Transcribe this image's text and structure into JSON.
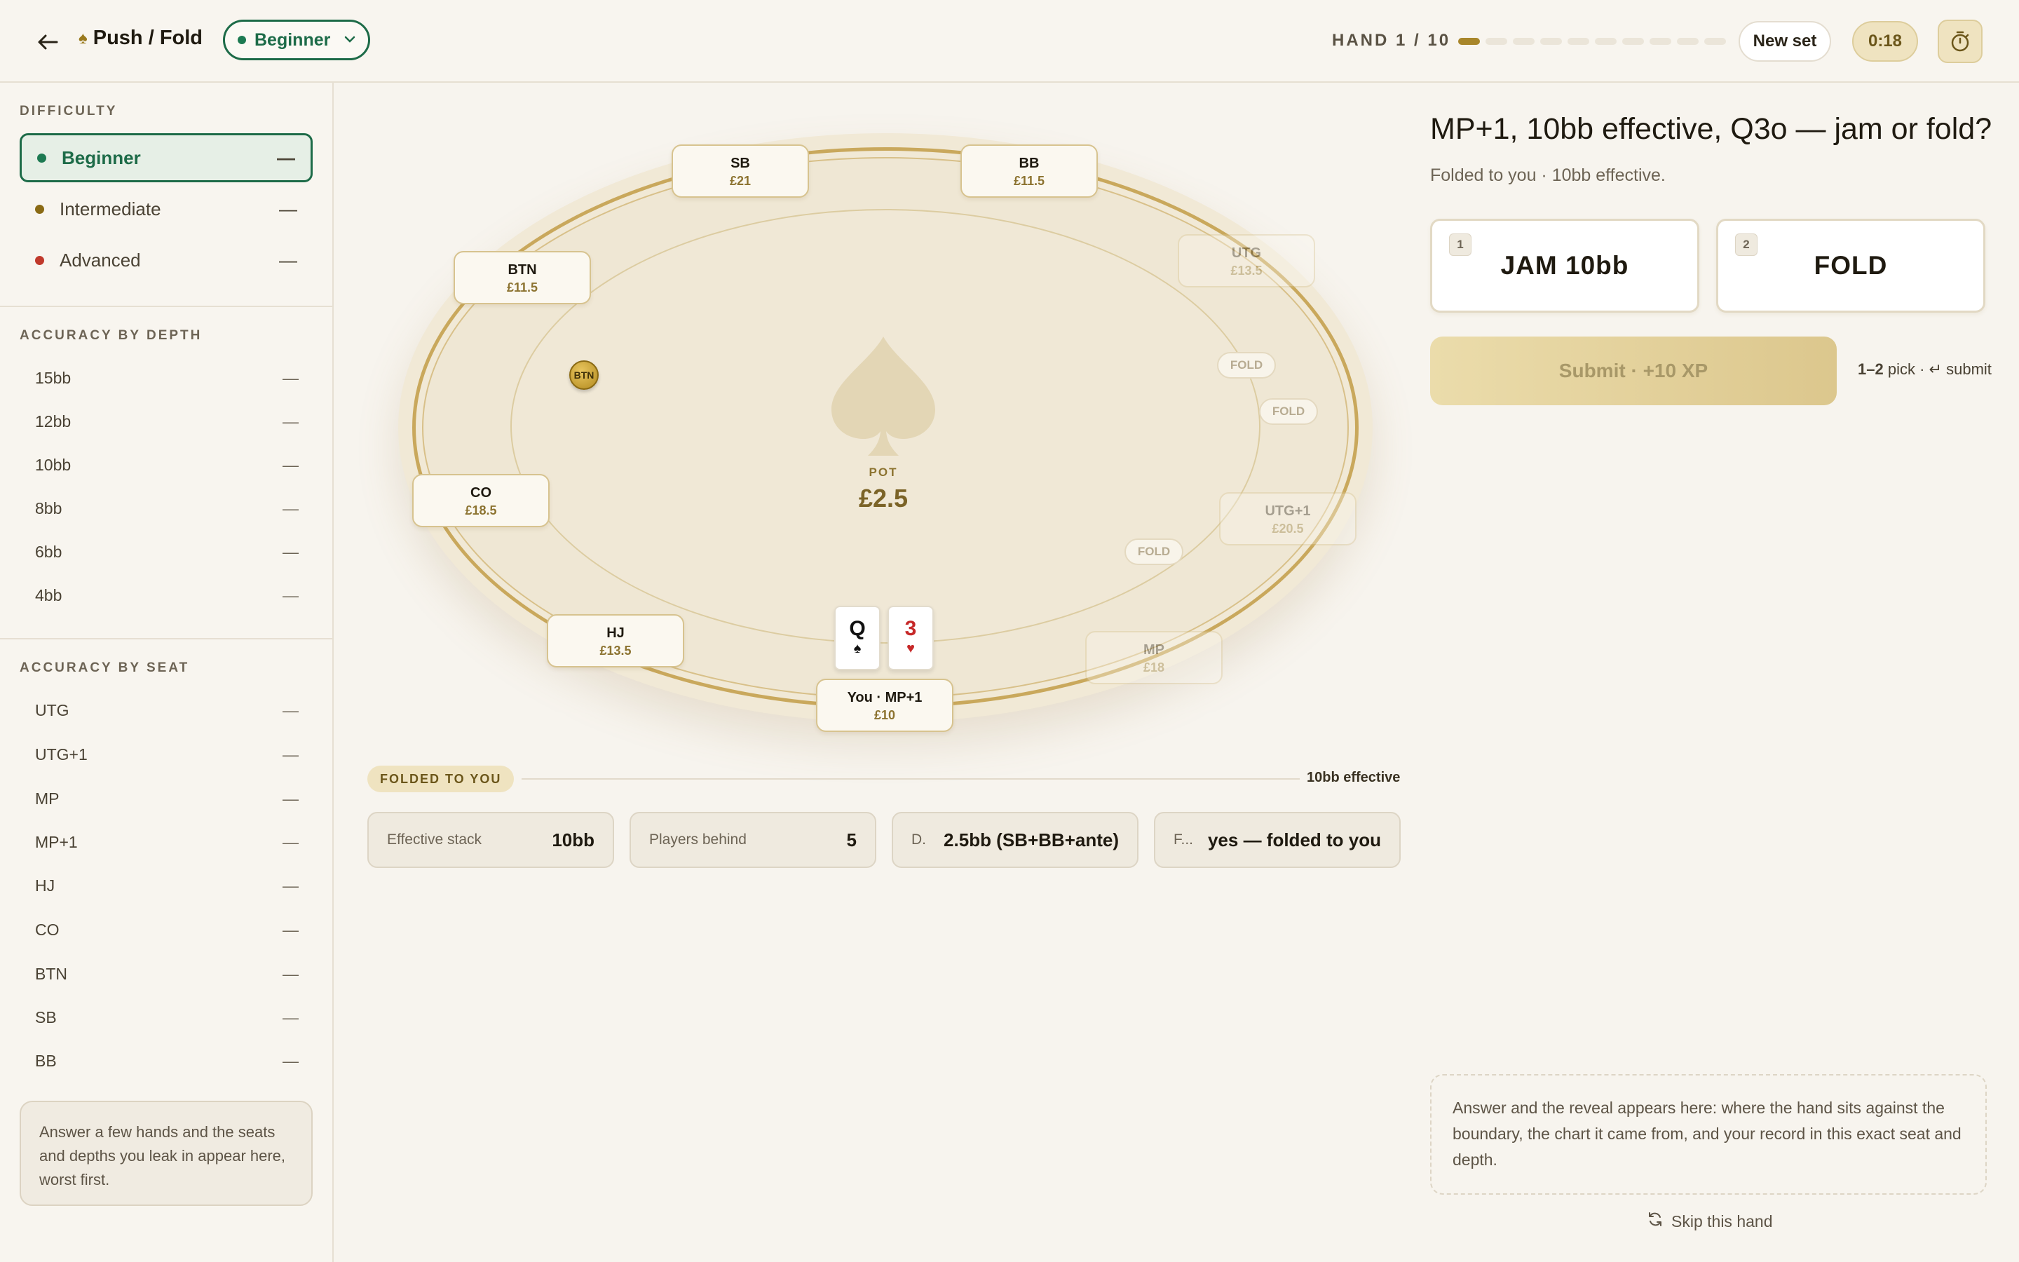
{
  "header": {
    "title": "Push / Fold",
    "difficulty": "Beginner",
    "hand_label": "HAND 1 / 10",
    "progress": {
      "current": 1,
      "total": 10
    },
    "new_set": "New set",
    "timer": "0:18"
  },
  "sidebar": {
    "difficulty_heading": "DIFFICULTY",
    "difficulty": [
      {
        "label": "Beginner",
        "value": "—",
        "color": "#1d7a52"
      },
      {
        "label": "Intermediate",
        "value": "—",
        "color": "#8a6a14"
      },
      {
        "label": "Advanced",
        "value": "—",
        "color": "#c0392b"
      }
    ],
    "depth_heading": "ACCURACY BY DEPTH",
    "depth": [
      {
        "label": "15bb",
        "value": "—"
      },
      {
        "label": "12bb",
        "value": "—"
      },
      {
        "label": "10bb",
        "value": "—"
      },
      {
        "label": "8bb",
        "value": "—"
      },
      {
        "label": "6bb",
        "value": "—"
      },
      {
        "label": "4bb",
        "value": "—"
      }
    ],
    "seat_heading": "ACCURACY BY SEAT",
    "seats": [
      {
        "label": "UTG",
        "value": "—"
      },
      {
        "label": "UTG+1",
        "value": "—"
      },
      {
        "label": "MP",
        "value": "—"
      },
      {
        "label": "MP+1",
        "value": "—"
      },
      {
        "label": "HJ",
        "value": "—"
      },
      {
        "label": "CO",
        "value": "—"
      },
      {
        "label": "BTN",
        "value": "—"
      },
      {
        "label": "SB",
        "value": "—"
      },
      {
        "label": "BB",
        "value": "—"
      }
    ],
    "leak_note": "Answer a few hands and the seats and depths you leak in appear here, worst first."
  },
  "table": {
    "seats": {
      "sb": {
        "name": "SB",
        "stack": "£21"
      },
      "bb": {
        "name": "BB",
        "stack": "£11.5"
      },
      "btn": {
        "name": "BTN",
        "stack": "£11.5"
      },
      "utg": {
        "name": "UTG",
        "stack": "£13.5"
      },
      "co": {
        "name": "CO",
        "stack": "£18.5"
      },
      "utg1": {
        "name": "UTG+1",
        "stack": "£20.5"
      },
      "hj": {
        "name": "HJ",
        "stack": "£13.5"
      },
      "mp": {
        "name": "MP",
        "stack": "£18"
      },
      "you": {
        "name": "You · MP+1",
        "stack": "£10"
      }
    },
    "fold_label": "FOLD",
    "dealer_chip": "BTN",
    "pot_label": "POT",
    "pot_value": "£2.5",
    "hero_cards": [
      {
        "rank": "Q",
        "suit": "♠",
        "color": "#111111"
      },
      {
        "rank": "3",
        "suit": "♥",
        "color": "#c62828"
      }
    ]
  },
  "context": {
    "tag": "FOLDED TO YOU",
    "effective": "10bb effective",
    "stats": [
      {
        "label": "Effective stack",
        "value": "10bb"
      },
      {
        "label": "Players behind",
        "value": "5"
      },
      {
        "label": "D.",
        "value": "2.5bb (SB+BB+ante)"
      },
      {
        "label": "F...",
        "value": "yes — folded to you"
      }
    ]
  },
  "panel": {
    "question": "MP+1, 10bb effective, Q3o — jam or fold?",
    "subtitle": "Folded to you · 10bb effective.",
    "choices": [
      {
        "key": "1",
        "label": "JAM 10bb"
      },
      {
        "key": "2",
        "label": "FOLD"
      }
    ],
    "submit": "Submit · +10 XP",
    "hint_keys": "1–2",
    "hint_pick": "pick ·",
    "hint_submit": "submit",
    "reveal": "Answer and the reveal appears here: where the hand sits against the boundary, the chart it came from, and your record in this exact seat and depth.",
    "skip": "Skip this hand"
  },
  "colors": {
    "accent_green": "#1d6b48",
    "gold": "#a8862a",
    "felt": "#f0e8d6"
  }
}
